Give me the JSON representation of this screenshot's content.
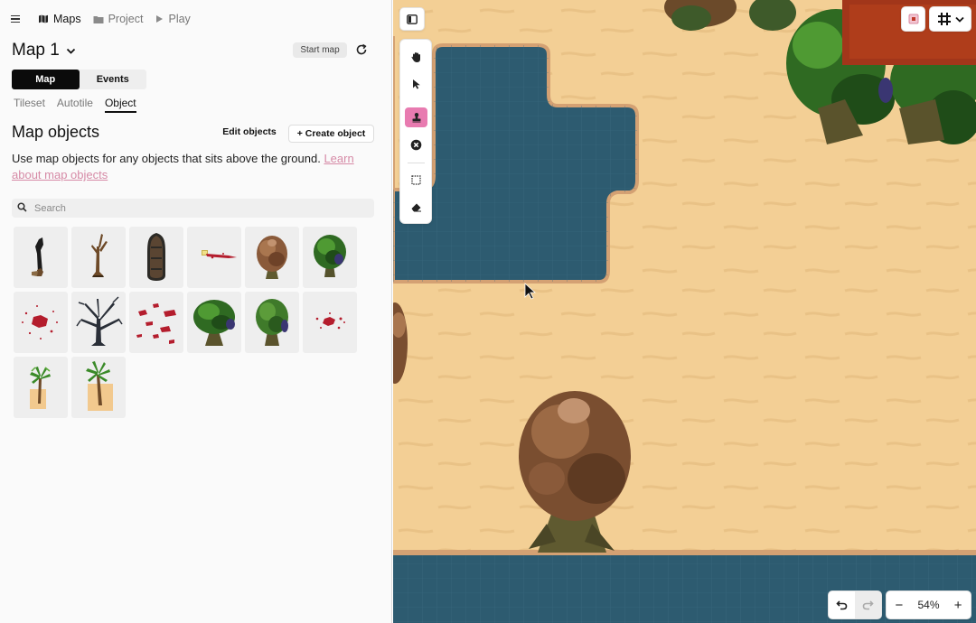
{
  "nav": {
    "menu_icon": "hamburger-icon",
    "breadcrumbs": [
      {
        "label": "Maps",
        "icon": "map-icon"
      },
      {
        "label": "Project",
        "icon": "folder-icon"
      },
      {
        "label": "Play",
        "icon": "play-icon"
      }
    ]
  },
  "header": {
    "title": "Map 1",
    "start_label": "Start map"
  },
  "mode_tabs": [
    "Map",
    "Events"
  ],
  "sub_tabs": [
    "Tileset",
    "Autotile",
    "Object"
  ],
  "section": {
    "title": "Map objects",
    "edit_label": "Edit objects",
    "create_label": "+ Create object",
    "description": "Use map objects for any objects that sits above the ground.",
    "link_text": "Learn about map objects"
  },
  "search": {
    "placeholder": "Search"
  },
  "objects": [
    "dead-tree-stump",
    "bare-tree",
    "wooden-boat",
    "blood-trail",
    "brown-bush-tree",
    "green-tree",
    "blood-splatter",
    "dark-dead-tree",
    "blood-drops",
    "green-oak-tree",
    "green-bush-tree",
    "small-blood-splatter",
    "small-palm-tree",
    "tall-palm-tree"
  ],
  "zoom": {
    "minus": "−",
    "value": "54%",
    "plus": "+"
  },
  "colors": {
    "accent_pink": "#e87bb0",
    "sand": "#f3cf95",
    "water": "#2d5b70",
    "link": "#d68aa6"
  }
}
